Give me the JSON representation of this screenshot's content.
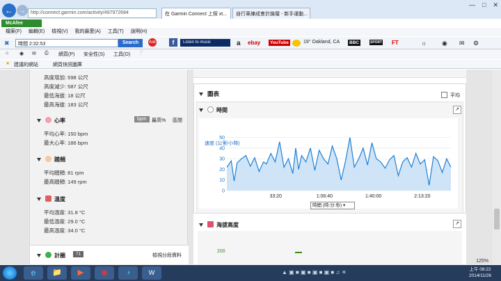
{
  "browser": {
    "address": "http://connect.garmin.com/activity/497972684",
    "tabs": [
      {
        "label": "在 Garmin Connect 上探 xt..."
      },
      {
        "label": "自行車練成會計論壇 - 新手運動..."
      }
    ]
  },
  "mcafee": {
    "label": "McAfee"
  },
  "menu": [
    "檔案(F)",
    "編輯(E)",
    "檢視(V)",
    "我的最愛(A)",
    "工具(T)",
    "說明(H)"
  ],
  "searchbar": {
    "value": "時間 2:32:53",
    "button": "Search",
    "listen": "Listen to music",
    "weather": "19° Oakland, CA",
    "brands": [
      "ebay",
      "YouTube",
      "BBC",
      "SPORT",
      "FT"
    ]
  },
  "commandbar": {
    "page": "網頁(P)",
    "safety": "安全性(S)",
    "tools": "工具(O)"
  },
  "favorites": {
    "item1": "建議的網站",
    "item2": "網頁快訊圖庫"
  },
  "left": {
    "elevation": {
      "gain": "高度增加: 598 公尺",
      "loss": "高度減少: 587 公尺",
      "min": "最低海拔: 18 公尺",
      "max": "最高海拔: 183 公尺"
    },
    "hr": {
      "title": "心率",
      "tag1": "bpm",
      "tag2": "最高%",
      "tag3": "區間",
      "avg": "平均心率: 150 bpm",
      "max": "最大心率: 186 bpm"
    },
    "cadence": {
      "title": "踏頻",
      "avg": "平均踏頻: 81 rpm",
      "max": "最高踏頻: 149 rpm"
    },
    "temp": {
      "title": "溫度",
      "avg": "平均溫度: 31.8 °C",
      "min": "最低溫度: 29.0 °C",
      "max": "最高溫度: 34.0 °C"
    },
    "laps": {
      "title": "計圈",
      "badge": "71",
      "link": "檢視分段資料"
    }
  },
  "right": {
    "charts_title": "圖表",
    "avg_toggle": "平均",
    "time_title": "時間",
    "xaxis_select": "時間 (時:分:秒)",
    "elev_title": "海拔高度"
  },
  "chart_data": [
    {
      "type": "area",
      "title": "",
      "ylabel": "速度 (公里/小時)",
      "xlabel": "時間 (時:分:秒)",
      "ylim": [
        0,
        55
      ],
      "yticks": [
        0,
        10,
        20,
        30,
        40,
        50
      ],
      "xticks": [
        "33:20",
        "1:06:40",
        "1:40:00",
        "2:13:20"
      ],
      "x_seconds": [
        0,
        180,
        300,
        420,
        600,
        780,
        960,
        1140,
        1320,
        1500,
        1620,
        1800,
        1980,
        2160,
        2340,
        2520,
        2700,
        2820,
        2940,
        3060,
        3240,
        3420,
        3600,
        3780,
        3960,
        4140,
        4320,
        4500,
        4680,
        4860,
        5040,
        5220,
        5400,
        5580,
        5760,
        5940,
        6120,
        6300,
        6480,
        6660,
        6840,
        7020,
        7200,
        7380,
        7560,
        7740,
        7920,
        8100,
        8280,
        8460,
        8640,
        8820,
        9000,
        9173
      ],
      "values": [
        22,
        28,
        9,
        26,
        30,
        33,
        23,
        31,
        18,
        27,
        25,
        35,
        27,
        46,
        22,
        30,
        16,
        40,
        20,
        33,
        27,
        40,
        19,
        38,
        30,
        25,
        42,
        30,
        10,
        28,
        50,
        22,
        30,
        40,
        24,
        45,
        30,
        27,
        21,
        29,
        33,
        14,
        27,
        31,
        22,
        35,
        25,
        29,
        5,
        32,
        28,
        17,
        30,
        22
      ],
      "grid": true,
      "color": "#1f7fd4",
      "fill": "#cfe5f7"
    },
    {
      "type": "line",
      "title": "",
      "yticks": [
        200
      ],
      "values": []
    }
  ],
  "taskbar": {
    "time": "上午 08:22",
    "date": "2014/11/26",
    "zoom": "125%"
  }
}
